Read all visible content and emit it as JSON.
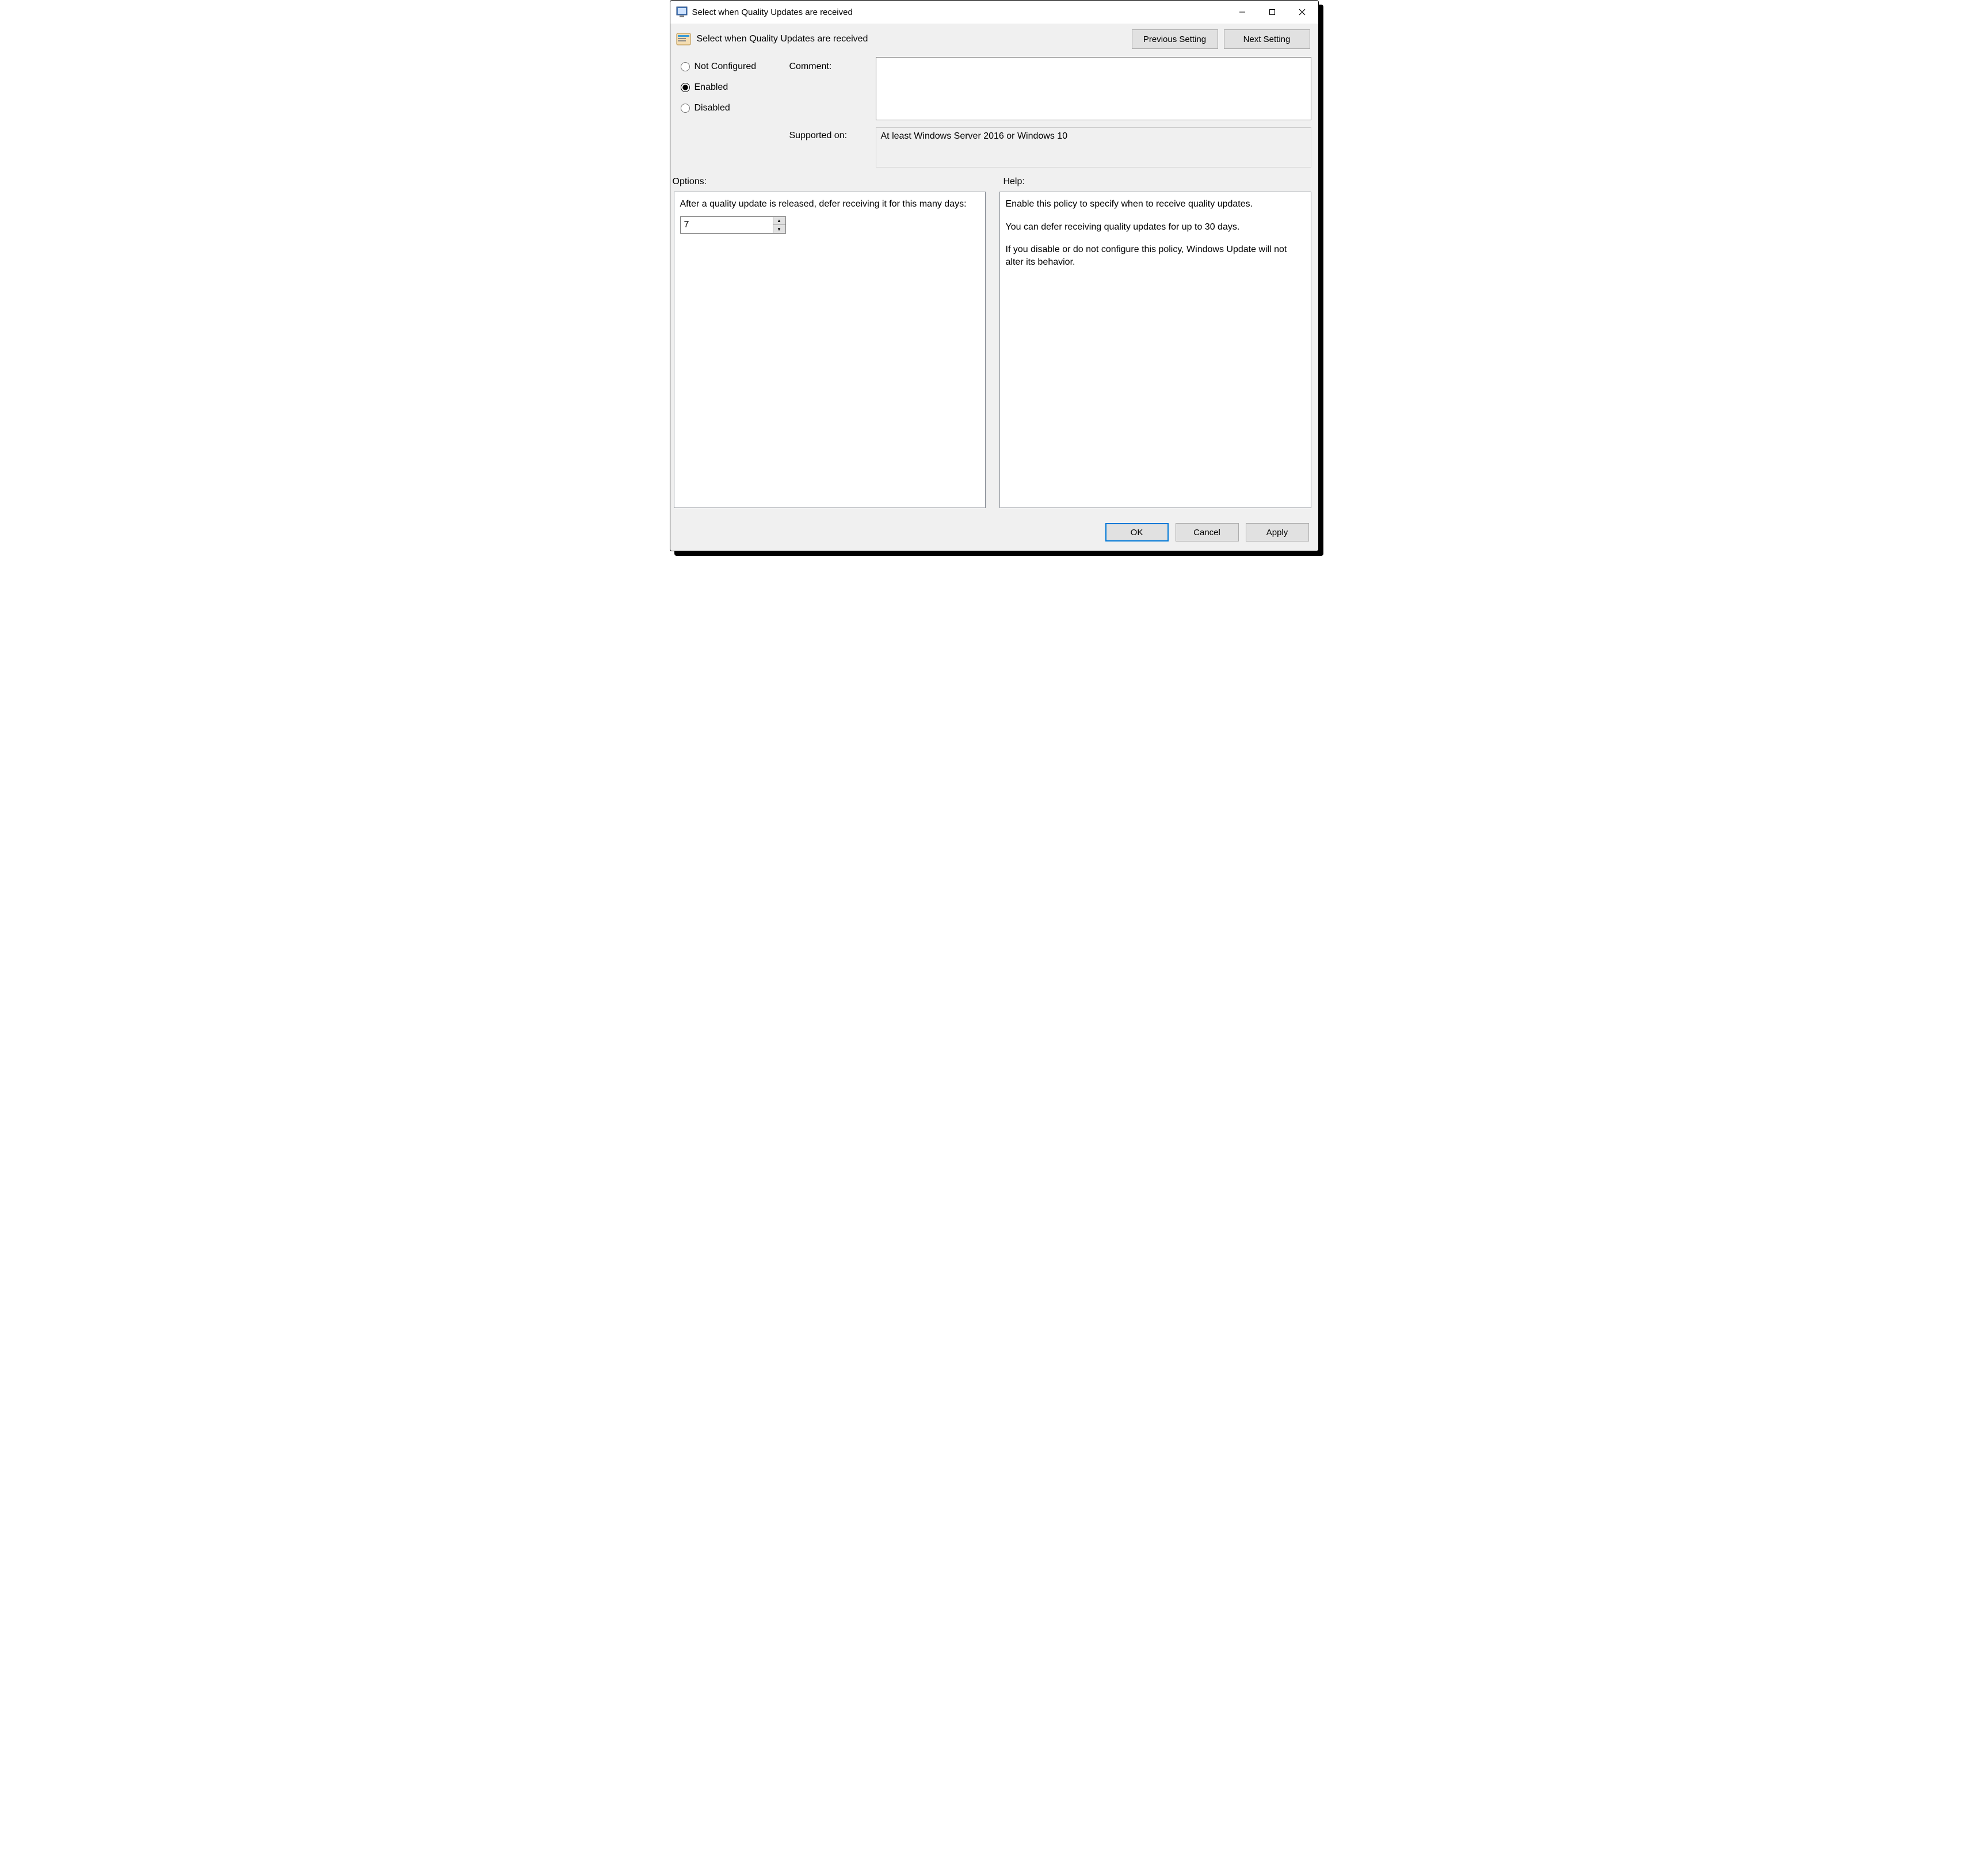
{
  "window": {
    "title": "Select when Quality Updates are received"
  },
  "header": {
    "title": "Select when Quality Updates are received",
    "prev_label": "Previous Setting",
    "next_label": "Next Setting"
  },
  "state": {
    "options": {
      "not_configured": "Not Configured",
      "enabled": "Enabled",
      "disabled": "Disabled"
    },
    "selected": "enabled"
  },
  "labels": {
    "comment": "Comment:",
    "supported_on": "Supported on:",
    "options": "Options:",
    "help": "Help:"
  },
  "comment": "",
  "supported_on": "At least Windows Server 2016 or Windows 10",
  "options": {
    "defer_label": "After a quality update is released, defer receiving it for this many days:",
    "defer_value": "7"
  },
  "help": {
    "p1": "Enable this policy to specify when to receive quality updates.",
    "p2": "You can defer receiving quality updates for up to 30 days.",
    "p3": "If you disable or do not configure this policy, Windows Update will not alter its behavior."
  },
  "footer": {
    "ok": "OK",
    "cancel": "Cancel",
    "apply": "Apply"
  }
}
